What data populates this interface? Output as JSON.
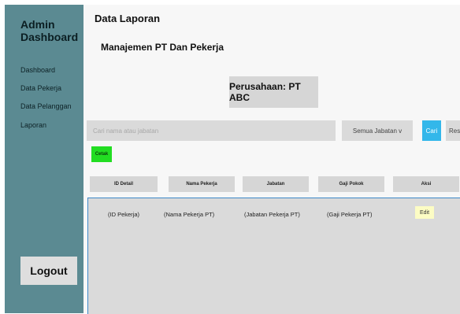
{
  "sidebar": {
    "title_line1": "Admin",
    "title_line2": "Dashboard",
    "items": [
      {
        "label": "Dashboard"
      },
      {
        "label": "Data Pekerja"
      },
      {
        "label": "Data Pelanggan"
      },
      {
        "label": "Laporan"
      }
    ],
    "logout_label": "Logout"
  },
  "main": {
    "title": "Data Laporan",
    "subtitle": "Manajemen PT Dan Pekerja",
    "company_label": "Perusahaan: PT ABC",
    "search": {
      "placeholder": "Cari nama atau jabatan"
    },
    "filter": {
      "selected": "Semua Jabatan v"
    },
    "search_button": "Cari",
    "reset_button": "Reset",
    "print_button": "Cetak",
    "table": {
      "headers": [
        "ID Detail",
        "Nama Pekerja",
        "Jabatan",
        "Gaji Pokok",
        "Aksi"
      ],
      "rows": [
        {
          "id": "(ID Pekerja)",
          "name": "(Nama Pekerja PT)",
          "position": "(Jabatan Pekerja PT)",
          "salary": "(Gaji Pekerja PT)",
          "action": "Edit"
        }
      ]
    }
  }
}
